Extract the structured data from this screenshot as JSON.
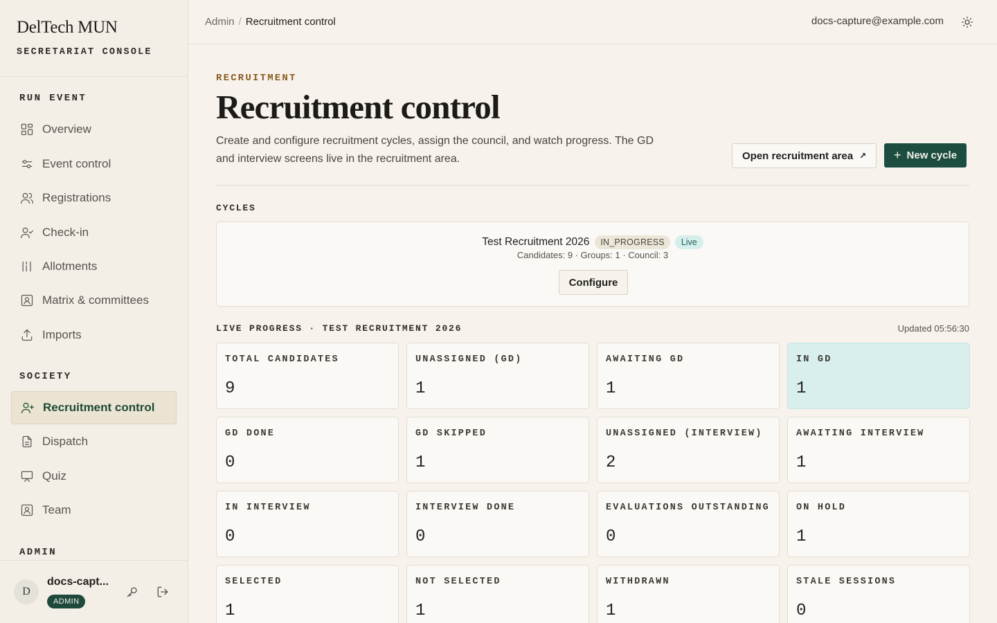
{
  "brand": {
    "name": "DelTech MUN",
    "subtitle": "SECRETARIAT CONSOLE"
  },
  "sidebar": {
    "sections": [
      {
        "label": "RUN EVENT"
      },
      {
        "label": "SOCIETY"
      },
      {
        "label": "ADMIN"
      }
    ],
    "items": [
      {
        "label": "Overview",
        "icon": "grid-icon"
      },
      {
        "label": "Event control",
        "icon": "sliders-icon"
      },
      {
        "label": "Registrations",
        "icon": "users-icon"
      },
      {
        "label": "Check-in",
        "icon": "user-check-icon"
      },
      {
        "label": "Allotments",
        "icon": "columns-icon"
      },
      {
        "label": "Matrix & committees",
        "icon": "id-card-icon"
      },
      {
        "label": "Imports",
        "icon": "upload-icon"
      },
      {
        "label": "Recruitment control",
        "icon": "user-plus-icon",
        "active": true
      },
      {
        "label": "Dispatch",
        "icon": "document-icon"
      },
      {
        "label": "Quiz",
        "icon": "presentation-icon"
      },
      {
        "label": "Team",
        "icon": "id-card-icon"
      }
    ],
    "user": {
      "initial": "D",
      "name": "docs-capt...",
      "role": "ADMIN"
    }
  },
  "topbar": {
    "breadcrumb": [
      "Admin",
      "Recruitment control"
    ],
    "separator": "/",
    "email": "docs-capture@example.com"
  },
  "page": {
    "eyebrow": "RECRUITMENT",
    "title": "Recruitment control",
    "description": "Create and configure recruitment cycles, assign the council, and watch progress. The GD and interview screens live in the recruitment area.",
    "open_area_label": "Open recruitment area",
    "open_area_arrow": "↗",
    "new_cycle_label": "New cycle",
    "new_cycle_plus": "+"
  },
  "cycles": {
    "heading": "CYCLES",
    "items": [
      {
        "name": "Test Recruitment 2026",
        "status": "IN_PROGRESS",
        "live": "Live",
        "meta": "Candidates: 9 · Groups: 1 · Council: 3",
        "configure_label": "Configure"
      }
    ]
  },
  "progress": {
    "heading": "LIVE PROGRESS · TEST RECRUITMENT 2026",
    "updated": "Updated 05:56:30",
    "accent_highlight": "#d9efee",
    "stats": [
      {
        "label": "TOTAL CANDIDATES",
        "value": "9"
      },
      {
        "label": "UNASSIGNED (GD)",
        "value": "1"
      },
      {
        "label": "AWAITING GD",
        "value": "1"
      },
      {
        "label": "IN GD",
        "value": "1",
        "highlight": true
      },
      {
        "label": "GD DONE",
        "value": "0"
      },
      {
        "label": "GD SKIPPED",
        "value": "1"
      },
      {
        "label": "UNASSIGNED (INTERVIEW)",
        "value": "2"
      },
      {
        "label": "AWAITING INTERVIEW",
        "value": "1"
      },
      {
        "label": "IN INTERVIEW",
        "value": "0"
      },
      {
        "label": "INTERVIEW DONE",
        "value": "0"
      },
      {
        "label": "EVALUATIONS OUTSTANDING",
        "value": "0"
      },
      {
        "label": "ON HOLD",
        "value": "1"
      },
      {
        "label": "SELECTED",
        "value": "1"
      },
      {
        "label": "NOT SELECTED",
        "value": "1"
      },
      {
        "label": "WITHDRAWN",
        "value": "1"
      },
      {
        "label": "STALE SESSIONS",
        "value": "0"
      }
    ]
  },
  "colors": {
    "brand_green": "#1d4d40",
    "eyebrow": "#8a5a1f",
    "background": "#f7f3ec"
  }
}
